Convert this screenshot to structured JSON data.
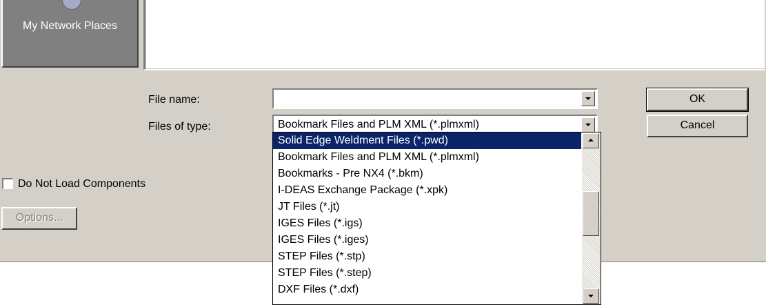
{
  "places": {
    "network_label": "My Network Places"
  },
  "form": {
    "file_name_label": "File name:",
    "file_name_value": "",
    "file_type_label": "Files of type:",
    "file_type_value": "Bookmark Files and PLM XML (*.plmxml)"
  },
  "buttons": {
    "ok": "OK",
    "cancel": "Cancel",
    "options": "Options..."
  },
  "options": {
    "do_not_load_label": "Do Not Load Components",
    "do_not_load_checked": false
  },
  "dropdown": {
    "items": [
      "Solid Edge Weldment Files (*.pwd)",
      "Bookmark Files and PLM XML (*.plmxml)",
      "Bookmarks - Pre NX4 (*.bkm)",
      "I-DEAS Exchange Package (*.xpk)",
      "JT Files (*.jt)",
      "IGES Files (*.igs)",
      "IGES Files (*.iges)",
      "STEP Files (*.stp)",
      "STEP Files (*.step)",
      "DXF Files (*.dxf)"
    ],
    "selected_index": 0
  },
  "colors": {
    "selection": "#0a246a",
    "dialog_bg": "#d4d0c8"
  }
}
